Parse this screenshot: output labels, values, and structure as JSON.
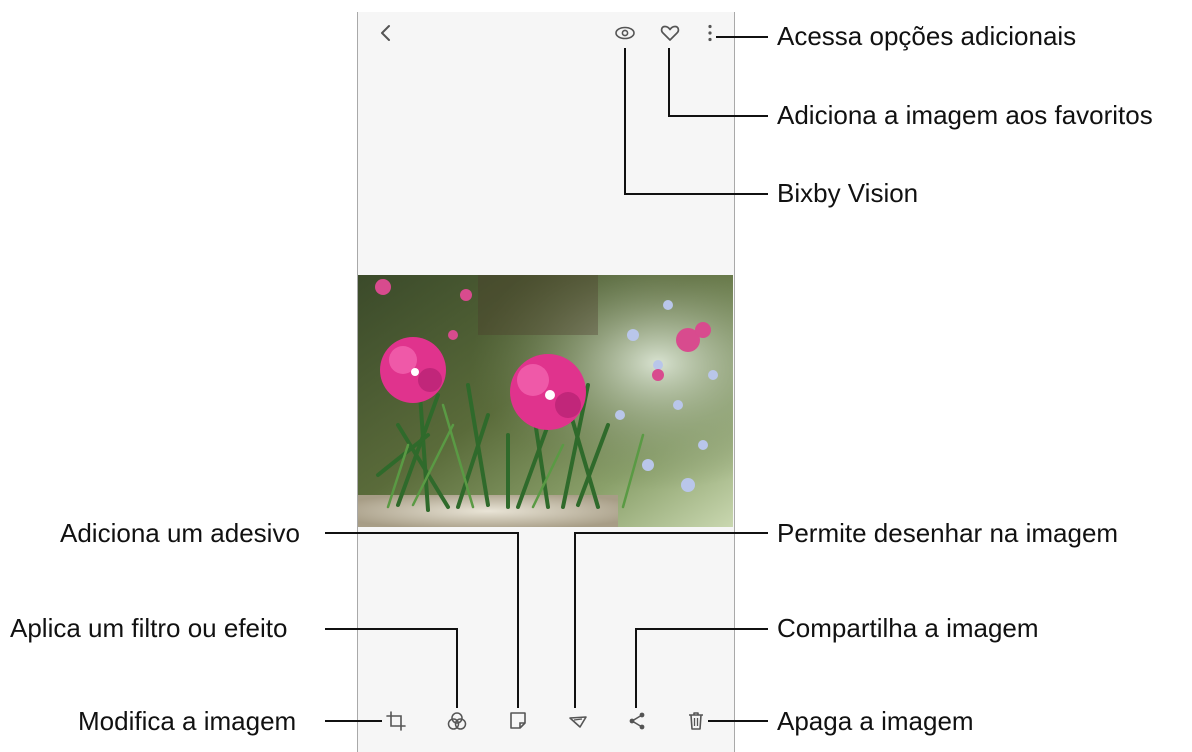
{
  "top_bar": {
    "back_icon": "back-icon",
    "bixby_icon": "bixby-vision-icon",
    "favorite_icon": "heart-icon",
    "more_icon": "more-options-icon"
  },
  "photo": {
    "subject": "pink and blue flowers"
  },
  "bottom_bar": {
    "icons": [
      "edit-crop-icon",
      "filter-effects-icon",
      "sticker-icon",
      "draw-icon",
      "share-icon",
      "delete-icon"
    ]
  },
  "callouts": {
    "more_options": "Acessa opções adicionais",
    "favorites": "Adiciona a imagem aos favoritos",
    "bixby": "Bixby Vision",
    "sticker": "Adiciona um adesivo",
    "filter": "Aplica um filtro ou efeito",
    "edit": "Modifica a imagem",
    "draw": "Permite desenhar na imagem",
    "share": "Compartilha a imagem",
    "delete": "Apaga a imagem"
  },
  "colors": {
    "screen_bg": "#f6f6f6",
    "icon": "#555555",
    "text": "#111111"
  }
}
